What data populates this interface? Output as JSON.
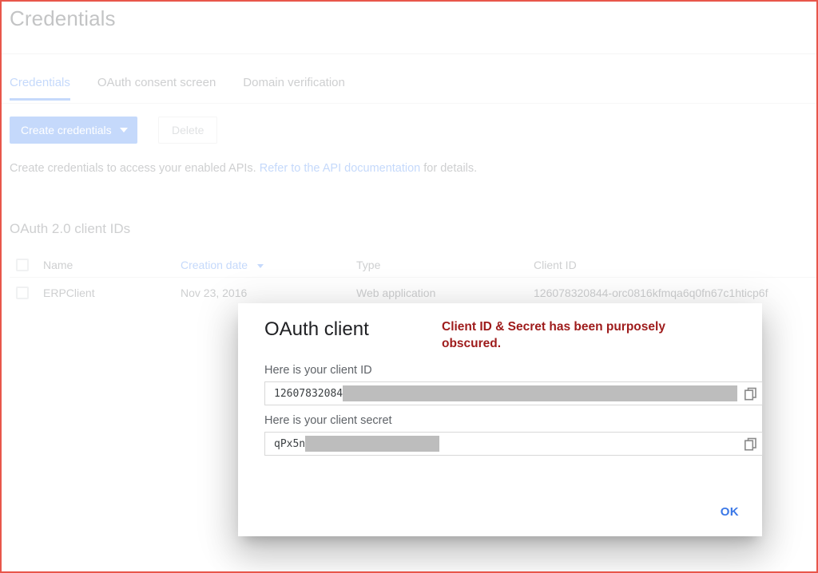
{
  "page": {
    "title": "Credentials",
    "tabs": [
      {
        "label": "Credentials",
        "active": true
      },
      {
        "label": "OAuth consent screen",
        "active": false
      },
      {
        "label": "Domain verification",
        "active": false
      }
    ],
    "toolbar": {
      "create_label": "Create credentials",
      "delete_label": "Delete"
    },
    "hint": {
      "before": "Create credentials to access your enabled APIs. ",
      "link": "Refer to the API documentation",
      "after": " for details."
    },
    "section_title": "OAuth 2.0 client IDs",
    "table": {
      "columns": {
        "name": "Name",
        "creation_date": "Creation date",
        "type": "Type",
        "client_id": "Client ID"
      },
      "sorted_by": "Creation date",
      "rows": [
        {
          "name": "ERPClient",
          "creation_date": "Nov 23, 2016",
          "type": "Web application",
          "client_id": "126078320844-orc0816kfmqa6q0fn67c1hticp6f"
        }
      ]
    }
  },
  "dialog": {
    "title": "OAuth client",
    "annotation": "Client ID & Secret has been purposely obscured.",
    "client_id": {
      "label": "Here is your client ID",
      "value": "12607832084",
      "copy_icon": "copy-icon"
    },
    "client_secret": {
      "label": "Here is your client secret",
      "value": "qPx5n",
      "copy_icon": "copy-icon"
    },
    "ok_label": "OK"
  },
  "colors": {
    "accent_blue": "#4285f4",
    "ok_blue": "#3b78e7",
    "annotation_red": "#9e1b1b",
    "frame_red": "#e8564a",
    "redaction_gray": "#bdbdbd"
  }
}
